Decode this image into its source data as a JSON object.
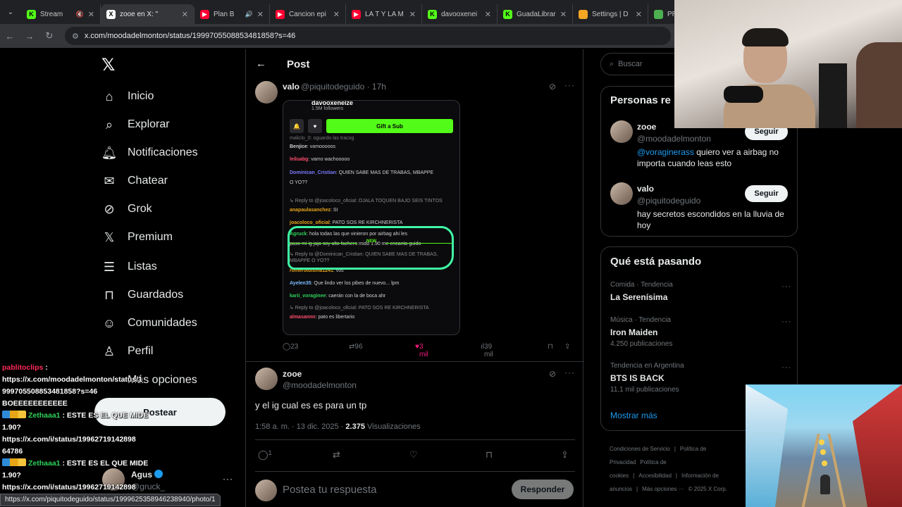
{
  "browser": {
    "tabs": [
      {
        "title": "Stream",
        "icon": "kick-icon",
        "color": "#53fc18",
        "muted": true
      },
      {
        "title": "zooe en X: \"",
        "icon": "x-icon",
        "color": "#ffffff",
        "active": true
      },
      {
        "title": "Plan B",
        "icon": "youtube-icon",
        "color": "#ff0033",
        "audio": true
      },
      {
        "title": "Cancion epi",
        "icon": "youtube-icon",
        "color": "#ff0033"
      },
      {
        "title": "LA T Y LA M",
        "icon": "youtube-icon",
        "color": "#ff0033"
      },
      {
        "title": "davooxenei",
        "icon": "kick-icon",
        "color": "#53fc18"
      },
      {
        "title": "GuadaLibrar",
        "icon": "kick-icon",
        "color": "#53fc18"
      },
      {
        "title": "Settings | D",
        "icon": "settings-icon",
        "color": "#f5a623"
      },
      {
        "title": "PROMIED",
        "icon": "site-icon",
        "color": "#4caf50"
      }
    ],
    "url": "x.com/moodadelmonton/status/1999705508853481858?s=46",
    "status_url": "https://x.com/piquitodeguido/status/1999625358946238940/photo/1"
  },
  "nav": {
    "items": [
      {
        "label": "Inicio",
        "icon": "home-icon"
      },
      {
        "label": "Explorar",
        "icon": "search-icon"
      },
      {
        "label": "Notificaciones",
        "icon": "bell-icon"
      },
      {
        "label": "Chatear",
        "icon": "mail-icon"
      },
      {
        "label": "Grok",
        "icon": "grok-icon"
      },
      {
        "label": "Premium",
        "icon": "x-icon"
      },
      {
        "label": "Listas",
        "icon": "list-icon"
      },
      {
        "label": "Guardados",
        "icon": "bookmark-icon"
      },
      {
        "label": "Comunidades",
        "icon": "people-icon"
      },
      {
        "label": "Perfil",
        "icon": "person-icon"
      },
      {
        "label": "Más opciones",
        "icon": "more-circle-icon"
      }
    ],
    "post_button": "Postear",
    "account": {
      "name": "Agus",
      "handle": "@gruck_"
    }
  },
  "post_page": {
    "title": "Post",
    "tweet1": {
      "name": "valo",
      "handle": "@piquitodeguido · 17h",
      "embed": {
        "channel": "davooxeneize",
        "followers": "1.5M followers",
        "gift_button": "Gift a Sub",
        "top_line": "maliclo_0: oguardo las tracog",
        "new_label": "NEW",
        "messages": [
          {
            "user": "Benjice",
            "text": "vamooooos",
            "color": "#d0d0d0"
          },
          {
            "user": "leiluabg",
            "text": "vamo wachooooo",
            "color": "#ff4d6d"
          },
          {
            "user": "Dominican_Cristian",
            "text": "QUIEN SABE MAS DE TRABAS, MBAPPE",
            "color": "#7b7bff"
          },
          {
            "user": "",
            "text": "O YO??",
            "color": "#d0d0d0"
          },
          {
            "user": "",
            "text": "↳ Reply to @joacoloco_oficial: OJALA TOQUEN BAJO SEIS TINTOS",
            "color": "#8a8a8a"
          },
          {
            "user": "anapaulasanchez",
            "text": "SI",
            "color": "#e6a516"
          },
          {
            "user": "joacoloco_oficial",
            "text": "PATO SOS RE KIRCHNERISTA",
            "color": "#e6a516"
          },
          {
            "user": "Agruck",
            "text": "hola todas las que vinieron por airbag ahi les",
            "color": "#2ed25a"
          },
          {
            "user": "",
            "text": "paso mi ig jaja soy alto fachero mido 1.90 me encanta guido",
            "color": "#d0d0d0"
          },
          {
            "user": "",
            "text": "↳ Reply to @Dominican_Cristian: QUIEN SABE MAS DE TRABAS,",
            "color": "#8a8a8a"
          },
          {
            "user": "",
            "text": "MBAPPE O YO??",
            "color": "#8a8a8a"
          },
          {
            "user": "romeroluisina1241",
            "text": "vos",
            "color": "#e6a516"
          },
          {
            "user": "Ayelen35",
            "text": "Que lindo ver los pibes de nuevo... lpm",
            "color": "#7bbcff"
          },
          {
            "user": "karii_voraginee",
            "text": "caerán con la de boca ahr",
            "color": "#2ed25a"
          },
          {
            "user": "",
            "text": "↳ Reply to @joacoloco_oficial: PATO SOS RE KIRCHNERISTA",
            "color": "#8a8a8a"
          },
          {
            "user": "almasannn",
            "text": "pato es libertario",
            "color": "#ff4d6d"
          }
        ]
      },
      "stats": {
        "replies": "23",
        "reposts": "96",
        "likes": "3 mil",
        "views": "39 mil"
      }
    },
    "tweet2": {
      "name": "zooe",
      "handle": "@moodadelmonton",
      "text": "y el ig cual es es para un tp",
      "time": "1:58 a. m. · 13 dic. 2025 · ",
      "views_count": "2.375",
      "views_label": "Visualizaciones",
      "replies": "1"
    },
    "reply": {
      "placeholder": "Postea tu respuesta",
      "button": "Responder"
    }
  },
  "sidebar": {
    "search_placeholder": "Buscar",
    "related_title": "Personas re",
    "related": [
      {
        "name": "zooe",
        "handle": "@moodadelmonton",
        "mention": "@voraginerass",
        "bio": " quiero ver a airbag no importa cuando leas esto",
        "follow": "Seguir"
      },
      {
        "name": "valo",
        "handle": "@piquitodeguido",
        "mention": "",
        "bio": "hay secretos escondidos en la lluvia de hoy",
        "follow": "Seguir"
      }
    ],
    "trends_title": "Qué está pasando",
    "trends": [
      {
        "category": "Comida · Tendencia",
        "name": "La Serenísima",
        "count": ""
      },
      {
        "category": "Música · Tendencia",
        "name": "Iron Maiden",
        "count": "4.250 publicaciones"
      },
      {
        "category": "Tendencia en Argentina",
        "name": "BTS IS BACK",
        "count": "11,1 mil publicaciones"
      }
    ],
    "show_more": "Mostrar más",
    "footer": [
      "Condiciones de Servicio",
      "|",
      "Política de Privacidad",
      "Política de cookies",
      "|",
      "Accesibilidad",
      "|",
      "Información de anuncios",
      "|",
      "Más opciones ···",
      "© 2025 X Corp."
    ]
  },
  "chat_overlay": {
    "lines": [
      {
        "user": "pablitoclips",
        "sep": " :",
        "badges": false
      },
      {
        "text": "https://x.com/moodadelmonton/status/1"
      },
      {
        "text": "999705508853481858?s=46"
      },
      {
        "text": "BOEEEEEEEEEEE"
      },
      {
        "user": "Zethaaa1",
        "sep": " : ESTE ES EL QUE MIDE",
        "badges": true
      },
      {
        "text": "1.90?"
      },
      {
        "text": "https://x.com/i/status/19962719142898"
      },
      {
        "text": "64786"
      },
      {
        "user": "Zethaaa1",
        "sep": " : ESTE ES EL QUE MIDE",
        "badges": true
      },
      {
        "text": "1.90?"
      },
      {
        "text": "https://x.com/i/status/19962719142898"
      },
      {
        "text": "64786"
      }
    ]
  }
}
